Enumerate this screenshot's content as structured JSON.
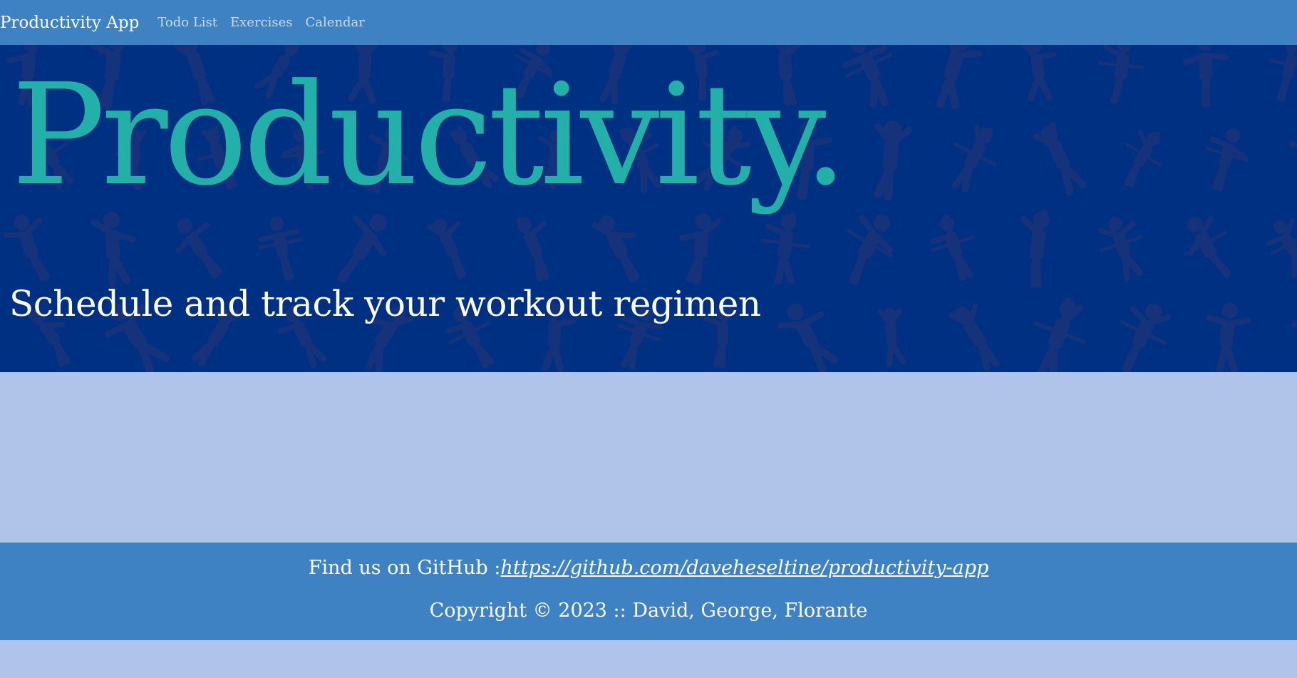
{
  "navbar": {
    "brand": "Productivity App",
    "links": [
      "Todo List",
      "Exercises",
      "Calendar"
    ]
  },
  "hero": {
    "title": "Productivity.",
    "subtitle": "Schedule and track your workout regimen",
    "background_image": "fitness-figures-pattern-icon"
  },
  "footer": {
    "github_prefix": "Find us on GitHub :",
    "github_url": "https://github.com/daveheseltine/productivity-app",
    "copyright": "Copyright © 2023 :: David, George, Florante"
  },
  "colors": {
    "navbar": "#3f82c4",
    "hero_background": "#003082",
    "title": "#22b0a8",
    "page_background": "#b0c4ea",
    "footer": "#3f82c4"
  }
}
